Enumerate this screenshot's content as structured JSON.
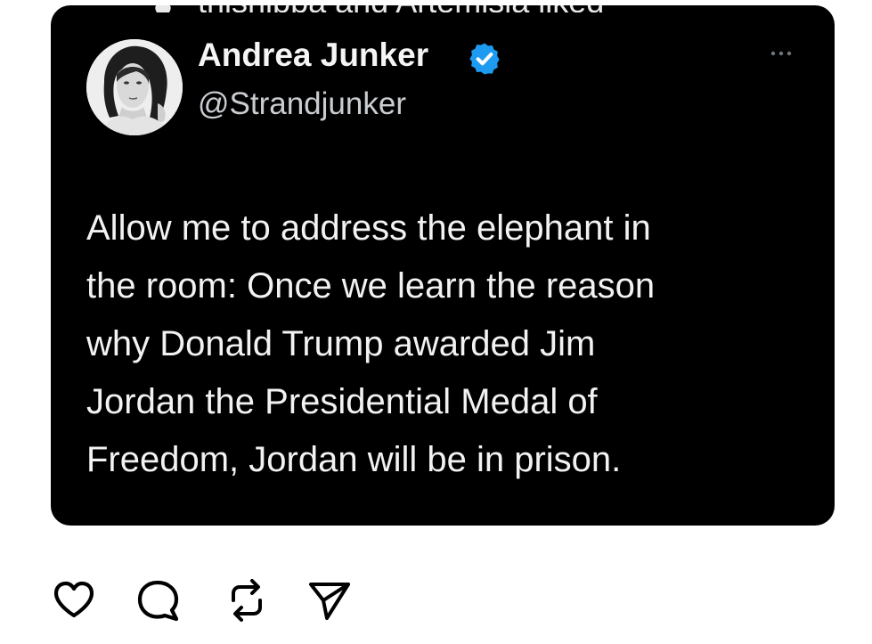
{
  "post": {
    "social_context": "thisnippa and Artemisia liked",
    "author": {
      "display_name": "Andrea Junker",
      "handle": "@Strandjunker",
      "verified": true
    },
    "text_lines": [
      "Allow me to address the elephant in",
      "the room: Once we learn the reason",
      "why Donald Trump awarded Jim",
      "Jordan the Presidential Medal of",
      "Freedom, Jordan will be in prison."
    ]
  },
  "icons": {
    "social_context": "heart-icon",
    "verified": "verified-badge-icon",
    "more": "more-options-icon",
    "actions": [
      "like-icon",
      "comment-icon",
      "repost-icon",
      "share-icon"
    ]
  },
  "colors": {
    "card_background": "#000000",
    "verified_blue": "#1d9bf0",
    "text": "#f2f2f2",
    "handle": "#c9cdd1",
    "action_icon": "#000000"
  }
}
